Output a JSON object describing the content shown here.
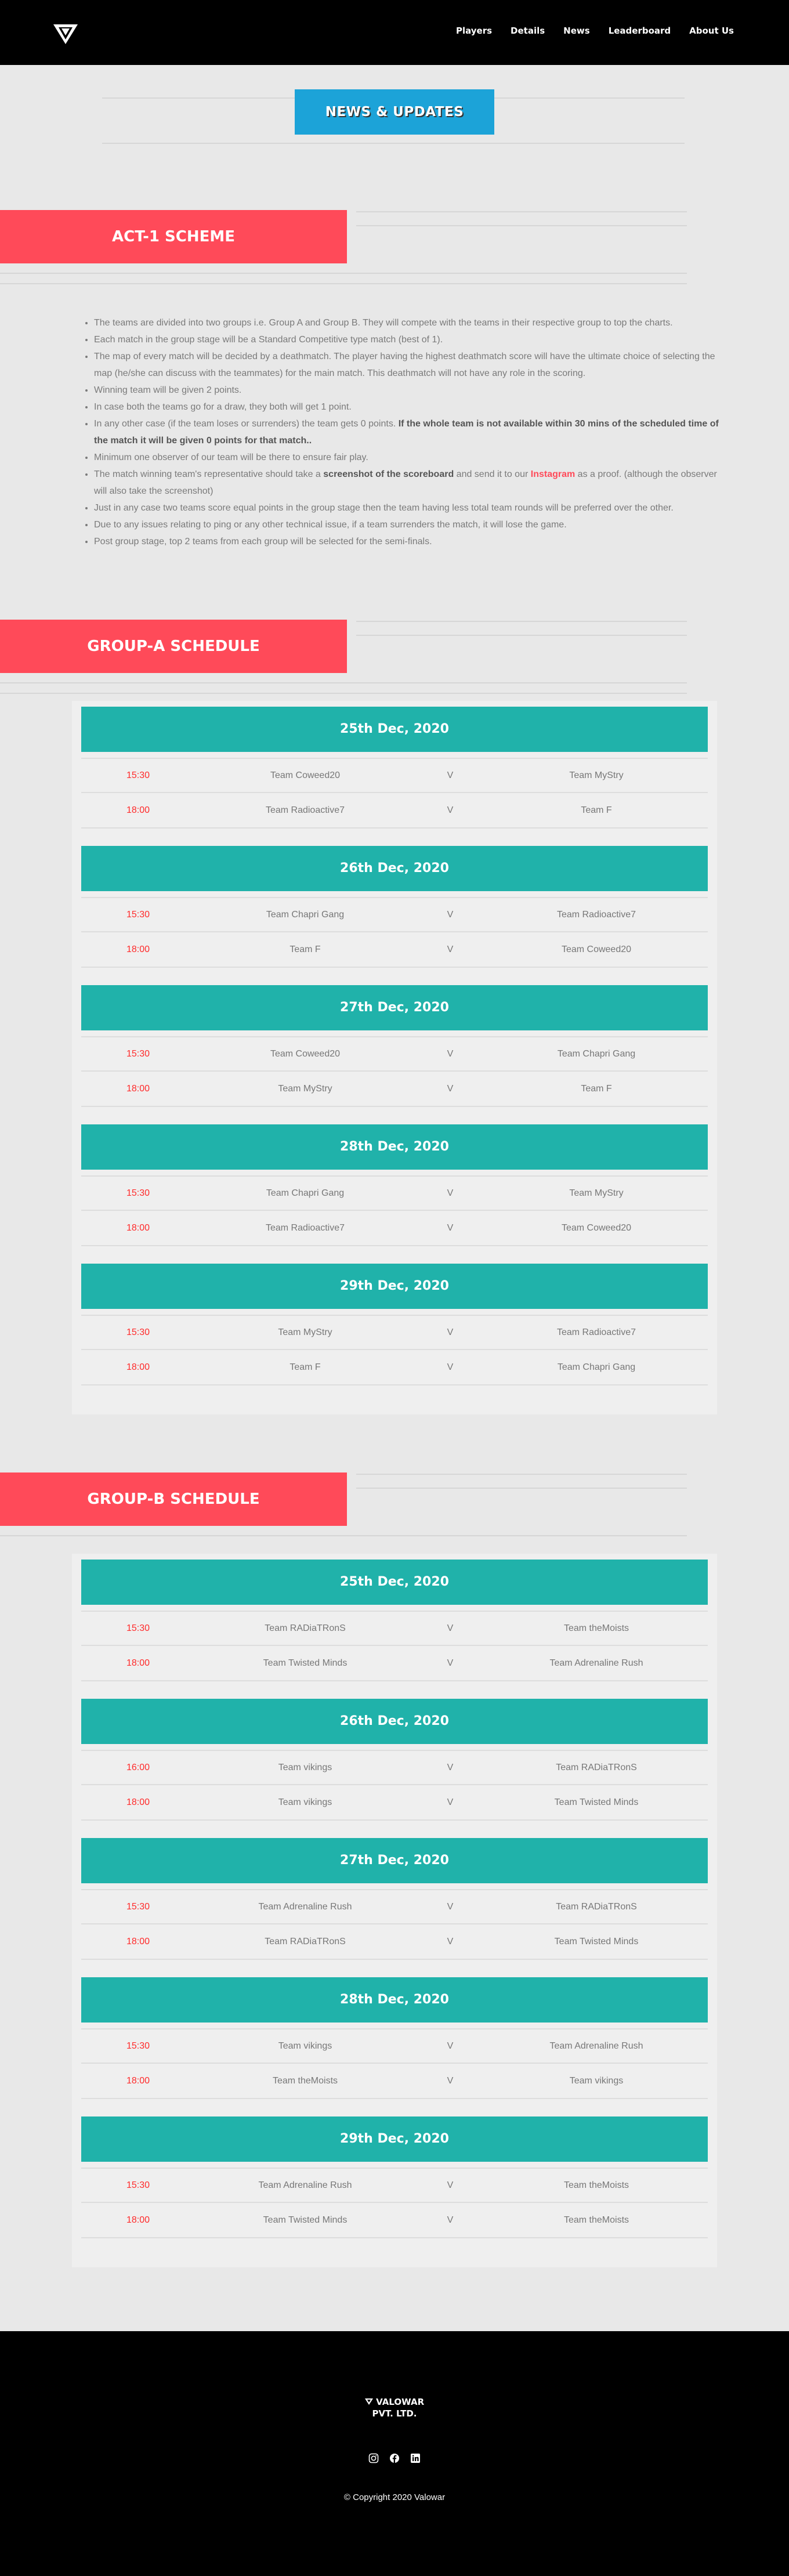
{
  "nav": {
    "links": [
      "Players",
      "Details",
      "News",
      "Leaderboard",
      "About Us"
    ]
  },
  "news": {
    "label": "NEWS & UPDATES"
  },
  "act1": {
    "title": "ACT-1 SCHEME",
    "rules": [
      {
        "text": "The teams are divided into two groups i.e. Group A and Group B. They will compete with the teams in their respective group to top the charts."
      },
      {
        "text": "Each match in the group stage will be a Standard Competitive type match (best of 1)."
      },
      {
        "text": "The map of every match will be decided by a deathmatch. The player having the highest deathmatch score will have the ultimate choice of selecting the map (he/she can discuss with the teammates) for the main match. This deathmatch will not have any role in the scoring."
      },
      {
        "text": "Winning team will be given 2 points."
      },
      {
        "text": "In case both the teams go for a draw, they both will get 1 point."
      },
      {
        "text": "In any other case (if the team loses or surrenders) the team gets 0 points. ",
        "bold": "If the whole team is not available within 30 mins of the scheduled time of the match it will be given 0 points for that match.."
      },
      {
        "text": "Minimum one observer of our team will be there to ensure fair play."
      },
      {
        "pre": "The match winning team's representative should take a ",
        "bold": "screenshot of the scoreboard",
        "mid": " and send it to our ",
        "red": "Instagram",
        "post": " as a proof. (although the observer will also take the screenshot)"
      },
      {
        "text": "Just in any case two teams score equal points in the group stage then the team having less total team rounds will be preferred over the other."
      },
      {
        "text": "Due to any issues relating to ping or any other technical issue, if a team surrenders the match, it will lose the game."
      },
      {
        "text": "Post group stage, top 2 teams from each group will be selected for the semi-finals."
      }
    ]
  },
  "groupA": {
    "title": "GROUP-A SCHEDULE",
    "days": [
      {
        "date": "25th Dec, 2020",
        "matches": [
          {
            "time": "15:30",
            "t1": "Team Coweed20",
            "v": "V",
            "t2": "Team MyStry"
          },
          {
            "time": "18:00",
            "t1": "Team Radioactive7",
            "v": "V",
            "t2": "Team F"
          }
        ]
      },
      {
        "date": "26th Dec, 2020",
        "matches": [
          {
            "time": "15:30",
            "t1": "Team Chapri Gang",
            "v": "V",
            "t2": "Team Radioactive7"
          },
          {
            "time": "18:00",
            "t1": "Team F",
            "v": "V",
            "t2": "Team Coweed20"
          }
        ]
      },
      {
        "date": "27th Dec, 2020",
        "matches": [
          {
            "time": "15:30",
            "t1": "Team Coweed20",
            "v": "V",
            "t2": "Team Chapri Gang"
          },
          {
            "time": "18:00",
            "t1": "Team MyStry",
            "v": "V",
            "t2": "Team F"
          }
        ]
      },
      {
        "date": "28th Dec, 2020",
        "matches": [
          {
            "time": "15:30",
            "t1": "Team Chapri Gang",
            "v": "V",
            "t2": "Team MyStry"
          },
          {
            "time": "18:00",
            "t1": "Team Radioactive7",
            "v": "V",
            "t2": "Team Coweed20"
          }
        ]
      },
      {
        "date": "29th Dec, 2020",
        "matches": [
          {
            "time": "15:30",
            "t1": "Team MyStry",
            "v": "V",
            "t2": "Team Radioactive7"
          },
          {
            "time": "18:00",
            "t1": "Team F",
            "v": "V",
            "t2": "Team Chapri Gang"
          }
        ]
      }
    ]
  },
  "groupB": {
    "title": "GROUP-B SCHEDULE",
    "days": [
      {
        "date": "25th Dec, 2020",
        "matches": [
          {
            "time": "15:30",
            "t1": "Team RADiaTRonS",
            "v": "V",
            "t2": "Team theMoists"
          },
          {
            "time": "18:00",
            "t1": "Team Twisted Minds",
            "v": "V",
            "t2": "Team Adrenaline Rush"
          }
        ]
      },
      {
        "date": "26th Dec, 2020",
        "matches": [
          {
            "time": "16:00",
            "t1": "Team vikings",
            "v": "V",
            "t2": "Team RADiaTRonS"
          },
          {
            "time": "18:00",
            "t1": "Team vikings",
            "v": "V",
            "t2": "Team Twisted Minds"
          }
        ]
      },
      {
        "date": "27th Dec, 2020",
        "matches": [
          {
            "time": "15:30",
            "t1": "Team Adrenaline Rush",
            "v": "V",
            "t2": "Team RADiaTRonS"
          },
          {
            "time": "18:00",
            "t1": "Team RADiaTRonS",
            "v": "V",
            "t2": "Team Twisted Minds"
          }
        ]
      },
      {
        "date": "28th Dec, 2020",
        "matches": [
          {
            "time": "15:30",
            "t1": "Team vikings",
            "v": "V",
            "t2": "Team Adrenaline Rush"
          },
          {
            "time": "18:00",
            "t1": "Team theMoists",
            "v": "V",
            "t2": "Team vikings"
          }
        ]
      },
      {
        "date": "29th Dec, 2020",
        "matches": [
          {
            "time": "15:30",
            "t1": "Team Adrenaline Rush",
            "v": "V",
            "t2": "Team theMoists"
          },
          {
            "time": "18:00",
            "t1": "Team Twisted Minds",
            "v": "V",
            "t2": "Team theMoists"
          }
        ]
      }
    ]
  },
  "footer": {
    "brand_line1": "VALOWAR",
    "brand_line2": "PVT. LTD.",
    "socials": [
      "instagram-icon",
      "facebook-icon",
      "linkedin-icon"
    ],
    "copyright": "© Copyright 2020 Valowar"
  },
  "colors": {
    "accent_red": "#ff4a59",
    "teal": "#20b2aa",
    "blue": "#1ca3d8",
    "time_red": "#ff2a2a"
  }
}
